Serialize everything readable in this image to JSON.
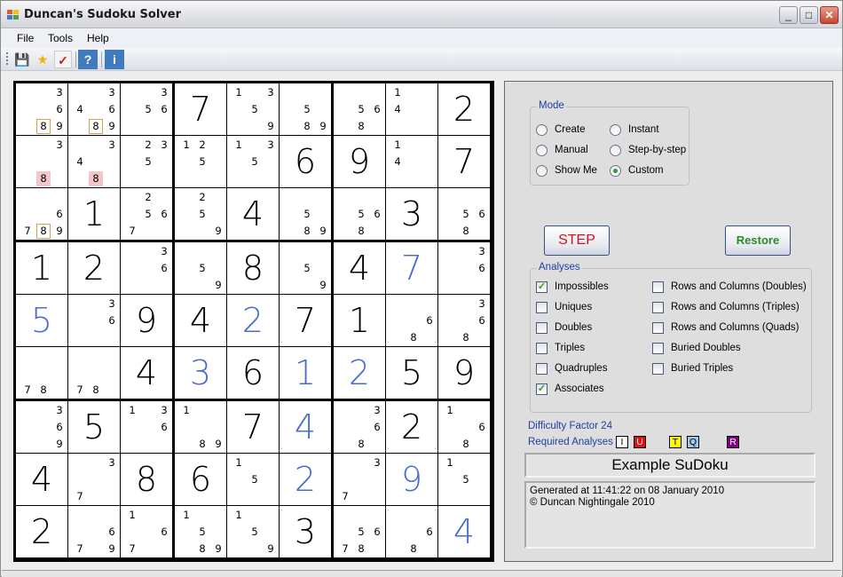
{
  "window": {
    "title": "Duncan's Sudoku Solver",
    "controls": {
      "minimize": "_",
      "maximize": "□",
      "close": "✕"
    }
  },
  "menu": [
    {
      "label": "File",
      "accel": "F"
    },
    {
      "label": "Tools",
      "accel": "T"
    },
    {
      "label": "Help",
      "accel": "H"
    }
  ],
  "toolbar": {
    "save_icon": "💾",
    "new_icon": "★",
    "check_icon": "✓",
    "help_label": "?",
    "info_label": "i"
  },
  "grid": {
    "rows": [
      [
        {
          "c": [
            3,
            6,
            9
          ],
          "boxed": [
            8
          ]
        },
        {
          "c": [
            3,
            4,
            6,
            9
          ],
          "boxed": [
            8
          ]
        },
        {
          "c": [
            3,
            5,
            6
          ]
        },
        {
          "v": 7
        },
        {
          "c": [
            1,
            3,
            5,
            9
          ]
        },
        {
          "c": [
            5,
            8,
            9
          ]
        },
        {
          "c": [
            5,
            6,
            8
          ]
        },
        {
          "c": [
            1,
            4
          ]
        },
        {
          "v": 2
        }
      ],
      [
        {
          "c": [
            3
          ],
          "pink": [
            8
          ]
        },
        {
          "c": [
            3,
            4
          ],
          "pink": [
            8
          ]
        },
        {
          "c": [
            2,
            3,
            5
          ]
        },
        {
          "c": [
            1,
            2,
            5
          ]
        },
        {
          "c": [
            1,
            3,
            5
          ]
        },
        {
          "v": 6
        },
        {
          "v": 9
        },
        {
          "c": [
            1,
            4
          ]
        },
        {
          "v": 7
        }
      ],
      [
        {
          "c": [
            6,
            7,
            9
          ],
          "boxed": [
            8
          ]
        },
        {
          "v": 1
        },
        {
          "c": [
            2,
            5,
            6,
            7
          ]
        },
        {
          "c": [
            2,
            5,
            9
          ]
        },
        {
          "v": 4
        },
        {
          "c": [
            5,
            8,
            9
          ]
        },
        {
          "c": [
            5,
            6,
            8
          ]
        },
        {
          "v": 3
        },
        {
          "c": [
            5,
            6,
            8
          ]
        }
      ],
      [
        {
          "v": 1
        },
        {
          "v": 2
        },
        {
          "c": [
            3,
            6
          ]
        },
        {
          "c": [
            5,
            9
          ]
        },
        {
          "v": 8
        },
        {
          "c": [
            5,
            9
          ]
        },
        {
          "v": 4
        },
        {
          "v": 7,
          "solved": true
        },
        {
          "c": [
            3,
            6
          ]
        }
      ],
      [
        {
          "v": 5,
          "solved": true
        },
        {
          "c": [
            3,
            6
          ]
        },
        {
          "v": 9
        },
        {
          "v": 4
        },
        {
          "v": 2,
          "solved": true
        },
        {
          "v": 7
        },
        {
          "v": 1
        },
        {
          "c": [
            6,
            8
          ]
        },
        {
          "c": [
            3,
            6,
            8
          ]
        }
      ],
      [
        {
          "c": [
            7,
            8
          ]
        },
        {
          "c": [
            7,
            8
          ]
        },
        {
          "v": 4
        },
        {
          "v": 3,
          "solved": true
        },
        {
          "v": 6
        },
        {
          "v": 1,
          "solved": true
        },
        {
          "v": 2,
          "solved": true
        },
        {
          "v": 5
        },
        {
          "v": 9
        }
      ],
      [
        {
          "c": [
            3,
            6,
            9
          ]
        },
        {
          "v": 5
        },
        {
          "c": [
            1,
            3,
            6
          ]
        },
        {
          "c": [
            1,
            8,
            9
          ]
        },
        {
          "v": 7
        },
        {
          "v": 4,
          "solved": true
        },
        {
          "c": [
            3,
            6,
            8
          ]
        },
        {
          "v": 2
        },
        {
          "c": [
            1,
            6,
            8
          ]
        }
      ],
      [
        {
          "v": 4
        },
        {
          "c": [
            3,
            7
          ]
        },
        {
          "v": 8
        },
        {
          "v": 6
        },
        {
          "c": [
            1,
            5
          ]
        },
        {
          "v": 2,
          "solved": true
        },
        {
          "c": [
            3,
            7
          ]
        },
        {
          "v": 9,
          "solved": true
        },
        {
          "c": [
            1,
            5
          ]
        }
      ],
      [
        {
          "v": 2
        },
        {
          "c": [
            6,
            7,
            9
          ]
        },
        {
          "c": [
            1,
            6,
            7
          ]
        },
        {
          "c": [
            1,
            5,
            8,
            9
          ]
        },
        {
          "c": [
            1,
            5,
            9
          ]
        },
        {
          "v": 3
        },
        {
          "c": [
            5,
            6,
            7,
            8
          ]
        },
        {
          "c": [
            6,
            8
          ]
        },
        {
          "v": 4,
          "solved": true
        }
      ]
    ]
  },
  "mode": {
    "label": "Mode",
    "options": [
      {
        "label": "Create",
        "selected": false
      },
      {
        "label": "Manual",
        "selected": false
      },
      {
        "label": "Show Me",
        "selected": false
      },
      {
        "label": "Instant",
        "selected": false
      },
      {
        "label": "Step-by-step",
        "selected": false
      },
      {
        "label": "Custom",
        "selected": true
      }
    ]
  },
  "buttons": {
    "step": "STEP",
    "restore": "Restore"
  },
  "analyses": {
    "label": "Analyses",
    "items": [
      {
        "label": "Impossibles",
        "checked": true
      },
      {
        "label": "Uniques",
        "checked": false
      },
      {
        "label": "Doubles",
        "checked": false
      },
      {
        "label": "Triples",
        "checked": false
      },
      {
        "label": "Quadruples",
        "checked": false
      },
      {
        "label": "Associates",
        "checked": true
      },
      {
        "label": "Rows and Columns (Doubles)",
        "checked": false
      },
      {
        "label": "Rows and Columns (Triples)",
        "checked": false
      },
      {
        "label": "Rows and Columns (Quads)",
        "checked": false
      },
      {
        "label": "Buried Doubles",
        "checked": false
      },
      {
        "label": "Buried Triples",
        "checked": false
      }
    ]
  },
  "difficulty": "Difficulty Factor 24",
  "required": {
    "label": "Required Analyses",
    "badges": [
      {
        "letter": "I",
        "bg": "#ffffff",
        "fg": "#000000"
      },
      {
        "letter": "U",
        "bg": "#e01010",
        "fg": "#ffffff"
      },
      {
        "letter": "T",
        "bg": "#ffff00",
        "fg": "#000000"
      },
      {
        "letter": "Q",
        "bg": "#9fc8ec",
        "fg": "#000000"
      },
      {
        "letter": "R",
        "bg": "#800080",
        "fg": "#ffffff"
      }
    ]
  },
  "puzzle_title": "Example SuDoku",
  "notes": [
    "Generated at 11:41:22 on 08 January 2010",
    "© Duncan Nightingale 2010"
  ],
  "colors": {
    "solved_digit": "#4a6bd0",
    "step_text": "#d0121e",
    "restore_text": "#2a8a2a",
    "group_label": "#1c3fa4",
    "boxed_border": "#d8a24a",
    "pink_highlight": "#f4c6cc"
  }
}
